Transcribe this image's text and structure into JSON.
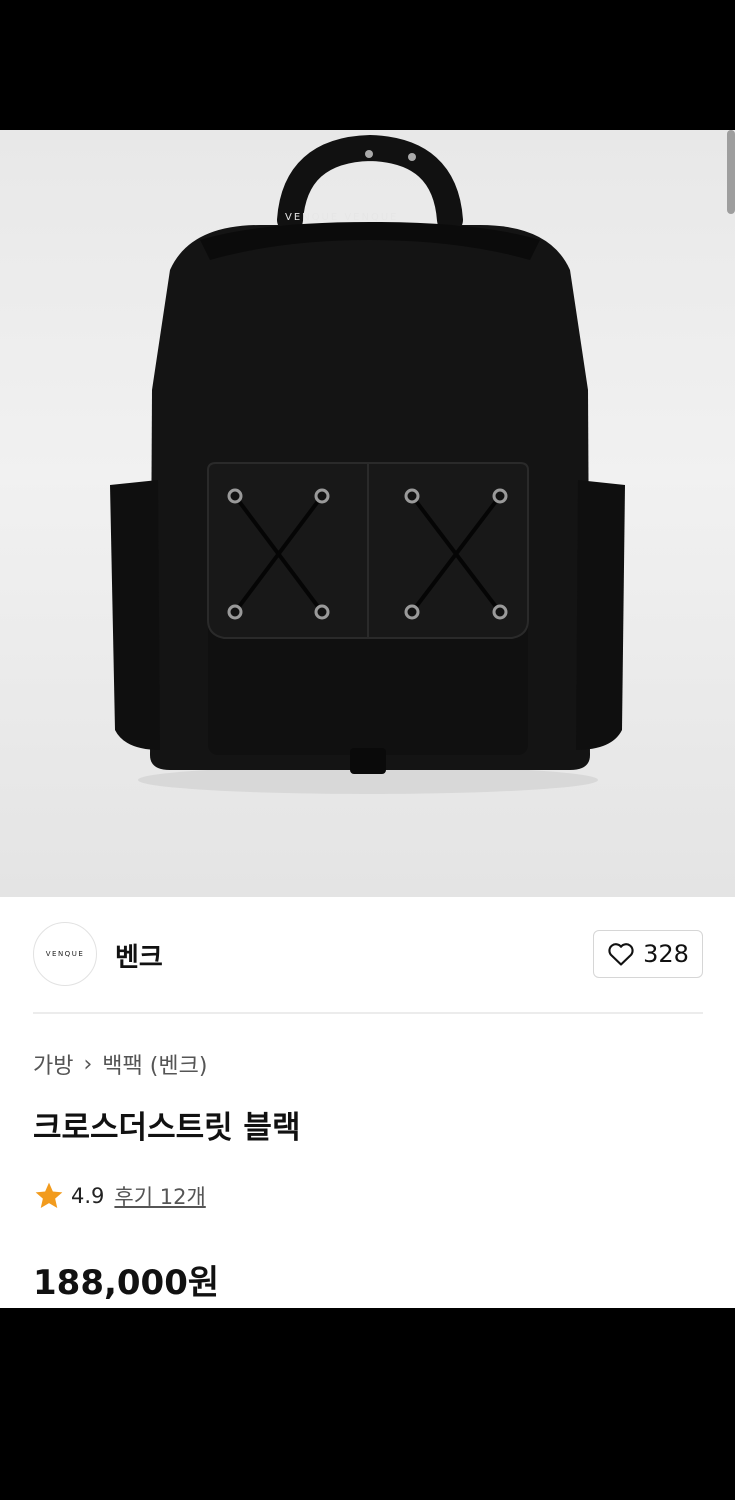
{
  "product_image": {
    "alt": ""
  },
  "brand": {
    "logo_text": "VENQUE",
    "name": "벤크"
  },
  "like": {
    "count": "328"
  },
  "breadcrumb": {
    "category": "가방",
    "subcategory": "백팩 (벤크)"
  },
  "product": {
    "title": "크로스더스트릿 블랙",
    "price": "188,000원"
  },
  "rating": {
    "score": "4.9",
    "reviews_label": "후기 12개"
  },
  "colors": {
    "star": "#f29b1d",
    "text": "#111111",
    "muted": "#555555"
  }
}
